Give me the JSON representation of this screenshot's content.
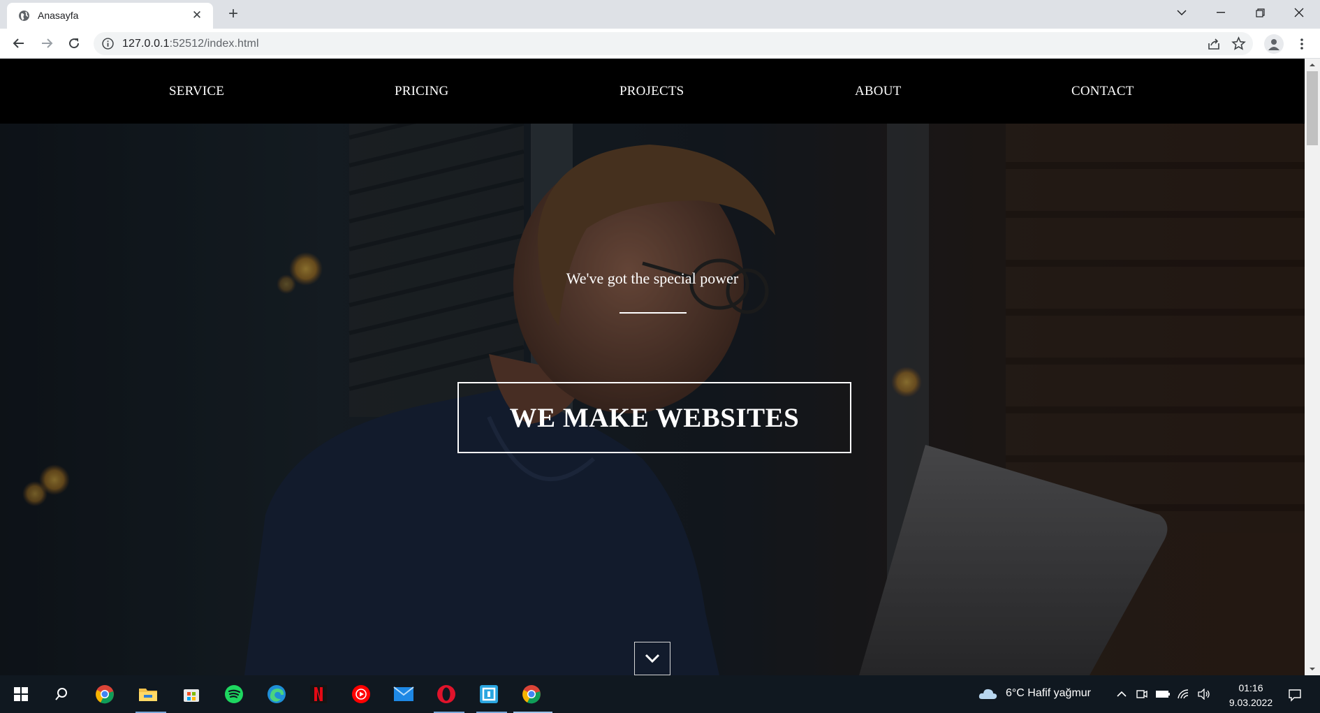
{
  "browser": {
    "tab_title": "Anasayfa",
    "tab_close_icon": "close-icon",
    "new_tab_icon": "plus-icon",
    "url_host": "127.0.0.1",
    "url_rest": ":52512/index.html"
  },
  "site": {
    "nav": [
      "SERVICE",
      "PRICING",
      "PROJECTS",
      "ABOUT",
      "CONTACT"
    ],
    "tagline": "We've got the special power",
    "headline": "WE MAKE WEBSITES",
    "scroll_icon": "chevron-down-icon"
  },
  "taskbar": {
    "apps": [
      "start",
      "search",
      "chrome",
      "file-explorer",
      "microsoft-store",
      "spotify",
      "edge",
      "netflix",
      "youtube-music",
      "mail",
      "opera",
      "remote-desktop",
      "chrome"
    ],
    "weather": "6°C  Hafif yağmur",
    "time": "01:16",
    "date": "9.03.2022"
  },
  "colors": {
    "nav_bg": "#000000",
    "taskbar_bg": "#101820",
    "tabstrip_bg": "#dee1e6"
  }
}
